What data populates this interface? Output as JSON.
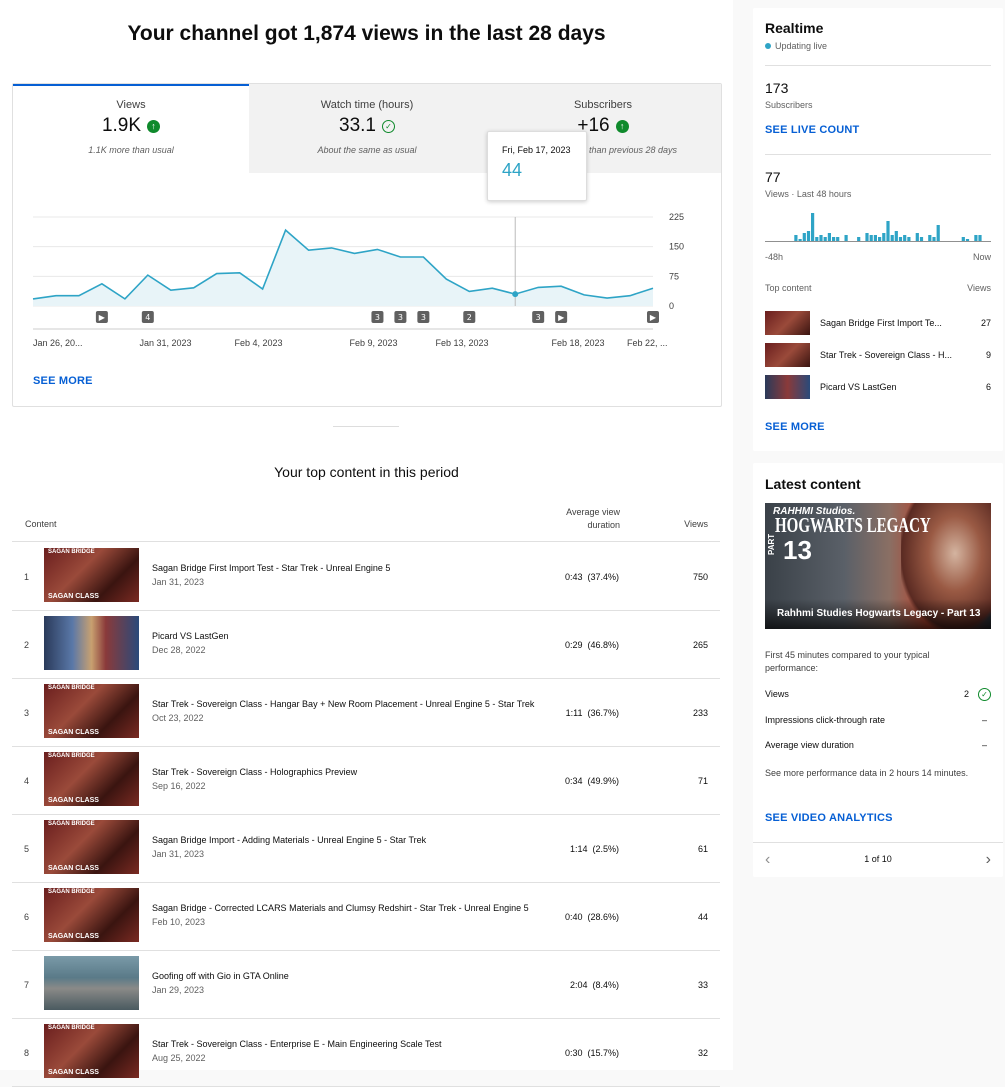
{
  "headline": "Your channel got 1,874 views in the last 28 days",
  "tabs": [
    {
      "label": "Views",
      "value": "1.9K",
      "subtext": "1.1K more than usual",
      "status": "up"
    },
    {
      "label": "Watch time (hours)",
      "value": "33.1",
      "subtext": "About the same as usual",
      "status": "same"
    },
    {
      "label": "Subscribers",
      "value": "+16",
      "subtext": "than previous 28 days",
      "status": "up"
    }
  ],
  "tooltip": {
    "date": "Fri, Feb 17, 2023",
    "value": "44"
  },
  "chart_data": {
    "type": "area",
    "y_ticks": [
      "225",
      "150",
      "75",
      "0"
    ],
    "ylim": [
      0,
      225
    ],
    "x_labels": [
      "Jan 26, 20...",
      "Jan 31, 2023",
      "Feb 4, 2023",
      "Feb 9, 2023",
      "Feb 13, 2023",
      "Feb 18, 2023",
      "Feb 22, ..."
    ],
    "values": [
      18,
      26,
      26,
      56,
      18,
      78,
      40,
      46,
      82,
      84,
      43,
      192,
      141,
      147,
      133,
      143,
      124,
      124,
      68,
      37,
      45,
      30,
      47,
      50,
      28,
      20,
      26,
      45
    ],
    "highlight_index": 21,
    "color": "#2ea4c6",
    "markers": [
      {
        "day": 3,
        "label": "▶"
      },
      {
        "day": 5,
        "label": "4"
      },
      {
        "day": 15,
        "label": "3"
      },
      {
        "day": 16,
        "label": "3"
      },
      {
        "day": 17,
        "label": "3"
      },
      {
        "day": 19,
        "label": "2"
      },
      {
        "day": 22,
        "label": "3"
      },
      {
        "day": 23,
        "label": "▶"
      },
      {
        "day": 27,
        "label": "▶"
      }
    ]
  },
  "see_more": "SEE MORE",
  "top_content": {
    "title": "Your top content in this period",
    "col_content": "Content",
    "col_avd": "Average view duration",
    "col_views": "Views",
    "rows": [
      {
        "rank": "1",
        "title": "Sagan Bridge First Import Test - Star Trek - Unreal Engine 5",
        "date": "Jan 31, 2023",
        "avd": "0:43",
        "pct": "(37.4%)",
        "views": "750",
        "thumb": "bridge"
      },
      {
        "rank": "2",
        "title": "Picard VS LastGen",
        "date": "Dec 28, 2022",
        "avd": "0:29",
        "pct": "(46.8%)",
        "views": "265",
        "thumb": "picard"
      },
      {
        "rank": "3",
        "title": "Star Trek - Sovereign Class - Hangar Bay + New Room Placement - Unreal Engine 5 - Star Trek",
        "date": "Oct 23, 2022",
        "avd": "1:11",
        "pct": "(36.7%)",
        "views": "233",
        "thumb": "bridge"
      },
      {
        "rank": "4",
        "title": "Star Trek - Sovereign Class - Holographics Preview",
        "date": "Sep 16, 2022",
        "avd": "0:34",
        "pct": "(49.9%)",
        "views": "71",
        "thumb": "bridge"
      },
      {
        "rank": "5",
        "title": "Sagan Bridge Import - Adding Materials - Unreal Engine 5 - Star Trek",
        "date": "Jan 31, 2023",
        "avd": "1:14",
        "pct": "(2.5%)",
        "views": "61",
        "thumb": "bridge"
      },
      {
        "rank": "6",
        "title": "Sagan Bridge - Corrected LCARS Materials and Clumsy Redshirt - Star Trek - Unreal Engine 5",
        "date": "Feb 10, 2023",
        "avd": "0:40",
        "pct": "(28.6%)",
        "views": "44",
        "thumb": "bridge"
      },
      {
        "rank": "7",
        "title": "Goofing off with Gio in GTA Online",
        "date": "Jan 29, 2023",
        "avd": "2:04",
        "pct": "(8.4%)",
        "views": "33",
        "thumb": "gta"
      },
      {
        "rank": "8",
        "title": "Star Trek - Sovereign Class - Enterprise E - Main Engineering Scale Test",
        "date": "Aug 25, 2022",
        "avd": "0:30",
        "pct": "(15.7%)",
        "views": "32",
        "thumb": "bridge"
      }
    ]
  },
  "realtime": {
    "title": "Realtime",
    "status": "Updating live",
    "subs_value": "173",
    "subs_label": "Subscribers",
    "live_count": "SEE LIVE COUNT",
    "views_value": "77",
    "views_label": "Views · Last 48 hours",
    "bars": [
      0,
      0,
      0,
      0,
      0,
      0,
      0,
      3,
      1,
      4,
      5,
      14,
      2,
      3,
      2,
      4,
      2,
      2,
      0,
      3,
      0,
      0,
      2,
      0,
      4,
      3,
      3,
      2,
      4,
      10,
      3,
      5,
      2,
      3,
      2,
      0,
      4,
      2,
      0,
      3,
      2,
      8,
      0,
      0,
      0,
      0,
      0,
      2,
      1,
      0,
      3,
      3,
      0,
      0
    ],
    "axis_left": "-48h",
    "axis_right": "Now",
    "top_label": "Top content",
    "top_views_label": "Views",
    "top": [
      {
        "title": "Sagan Bridge First Import Te...",
        "views": "27",
        "thumb": "bridge"
      },
      {
        "title": "Star Trek - Sovereign Class - H...",
        "views": "9",
        "thumb": "bridge"
      },
      {
        "title": "Picard VS LastGen",
        "views": "6",
        "thumb": "picard"
      }
    ],
    "see_more": "SEE MORE"
  },
  "latest": {
    "title": "Latest content",
    "thumb_brand": "RAHHMI Studios.",
    "thumb_heading": "HOGWARTS LEGACY",
    "thumb_part": "PART",
    "thumb_number": "13",
    "video_title": "Rahhmi Studies Hogwarts Legacy - Part 13",
    "intro": "First 45 minutes compared to your typical performance:",
    "metrics": [
      {
        "label": "Views",
        "value": "2"
      },
      {
        "label": "Impressions click-through rate",
        "value": "–"
      },
      {
        "label": "Average view duration",
        "value": "–"
      }
    ],
    "note": "See more performance data in 2 hours 14 minutes.",
    "analytics": "SEE VIDEO ANALYTICS",
    "pager": "1 of 10"
  },
  "thumb_texts": {
    "bridge_top": "SAGAN BRIDGE",
    "bridge_bottom": "SAGAN CLASS"
  },
  "colors": {
    "accent": "#065fd4",
    "chart": "#2ea4c6",
    "up": "#0f8a2c"
  }
}
